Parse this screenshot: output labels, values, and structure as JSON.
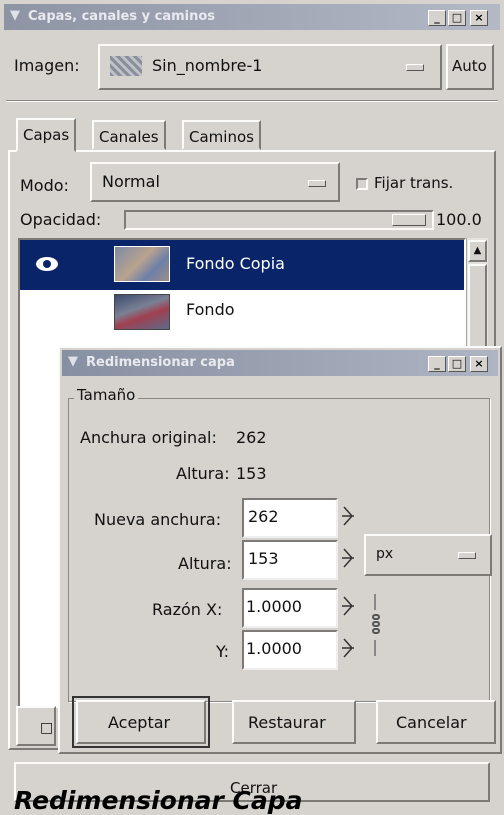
{
  "main_window": {
    "title": "Capas, canales y caminos",
    "image_label": "Imagen:",
    "image_value": "Sin_nombre-1",
    "auto_button": "Auto",
    "tabs": [
      {
        "label": "Capas",
        "active": true
      },
      {
        "label": "Canales",
        "active": false
      },
      {
        "label": "Caminos",
        "active": false
      }
    ],
    "mode_label": "Modo:",
    "mode_value": "Normal",
    "keep_trans_label": "Fijar trans.",
    "opacity_label": "Opacidad:",
    "opacity_value": "100.0",
    "layers": [
      {
        "name": "Fondo Copia",
        "visible": true,
        "selected": true
      },
      {
        "name": "Fondo",
        "visible": false,
        "selected": false
      }
    ],
    "close_button": "Cerrar"
  },
  "dialog": {
    "title": "Redimensionar capa",
    "size_group_label": "Tamaño",
    "original_width_label": "Anchura original:",
    "original_width_value": "262",
    "original_height_label": "Altura:",
    "original_height_value": "153",
    "new_width_label": "Nueva anchura:",
    "new_width_value": "262",
    "new_height_label": "Altura:",
    "new_height_value": "153",
    "unit_value": "px",
    "ratio_x_label": "Razón X:",
    "ratio_x_value": "1.0000",
    "ratio_y_label": "Y:",
    "ratio_y_value": "1.0000",
    "ok_button": "Aceptar",
    "reset_button": "Restaurar",
    "cancel_button": "Cancelar"
  },
  "caption": "Redimensionar Capa",
  "colors": {
    "selection": "#0a246a",
    "window_bg": "#d6d3ce",
    "titlebar": "#8d94a4"
  }
}
